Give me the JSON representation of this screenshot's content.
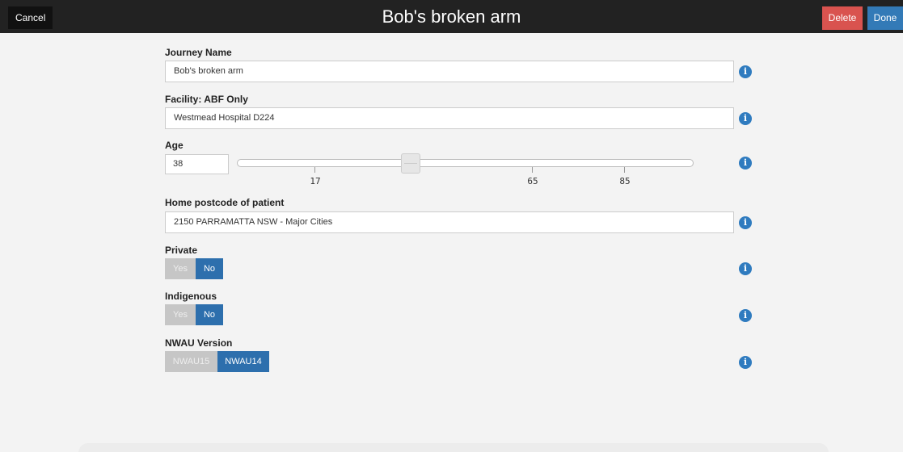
{
  "header": {
    "cancel_label": "Cancel",
    "title": "Bob's broken arm",
    "delete_label": "Delete",
    "done_label": "Done"
  },
  "form": {
    "journey_name": {
      "label": "Journey Name",
      "value": "Bob's broken arm"
    },
    "facility": {
      "label": "Facility: ABF Only",
      "value": "Westmead Hospital D224"
    },
    "age": {
      "label": "Age",
      "value": "38",
      "slider_value": 38,
      "ticks": [
        "17",
        "65",
        "85"
      ]
    },
    "postcode": {
      "label": "Home postcode of patient",
      "value": "2150 PARRAMATTA NSW - Major Cities"
    },
    "private": {
      "label": "Private",
      "options": [
        "Yes",
        "No"
      ],
      "selected": "No"
    },
    "indigenous": {
      "label": "Indigenous",
      "options": [
        "Yes",
        "No"
      ],
      "selected": "No"
    },
    "nwau_version": {
      "label": "NWAU Version",
      "options": [
        "NWAU15",
        "NWAU14"
      ],
      "selected": "NWAU14"
    }
  },
  "info_icon_glyph": "i",
  "colors": {
    "header_bg": "#222222",
    "delete": "#d9534f",
    "primary": "#337ab7",
    "info": "#2f7bbf"
  }
}
